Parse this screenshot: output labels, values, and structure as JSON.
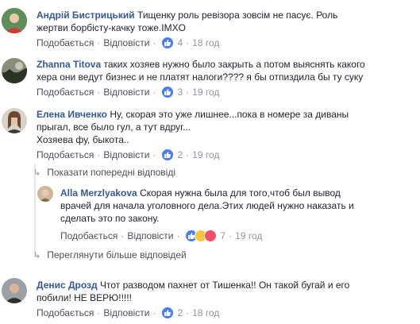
{
  "comments": [
    {
      "author": "Андрій Бистрицький",
      "text_line1": "Тищенку роль ревізора зовсім не пасує. Роль",
      "text_line2": "жертви борбісту-качку тоже.IMXO",
      "like_label": "Подобається",
      "reply_label": "Відповісти",
      "reaction_count": "4",
      "time": "18 год",
      "avatar_icon": "user-avatar-icon"
    },
    {
      "author": "Zhanna Titova",
      "text_line1": "таких хозяев нужно было закрыть а потом выяснять какого",
      "text_line2": "хера они ведут бизнес и не платят налоги???? я бы отпиздила бы ту суку",
      "like_label": "Подобається",
      "reply_label": "Відповісти",
      "reaction_count": "3",
      "time": "19 год",
      "avatar_icon": "user-avatar-icon"
    },
    {
      "author": "Елена Ивченко",
      "text_line1": "Ну, скорая это уже лишнее...пока в номере за диваны",
      "text_line2": "прыгал, все было гул, а тут вдруг...",
      "text_line3": "Хозяева фу, быкота..",
      "like_label": "Подобається",
      "reply_label": "Відповісти",
      "reaction_count": "2",
      "time": "19 год",
      "avatar_icon": "user-avatar-icon"
    }
  ],
  "show_previous_replies": "Показати попередні відповіді",
  "reply": {
    "author": "Alla Merzlyakova",
    "text_line1": "Скорая нужна была для того,чтоб был вывод",
    "text_line2": "врачей для начала уголовного дела.Этих людей нужно наказать и",
    "text_line3": "сделать это по закону.",
    "like_label": "Подобається",
    "reply_label": "Відповісти",
    "reaction_count": "7",
    "time": "19 год"
  },
  "show_more_replies": "Переглянути більше відповідей",
  "last_comment": {
    "author": "Денис Дрозд",
    "text_line1": "Чтот разводом пахнет от Тишенка!! Он такой бугай и его",
    "text_line2": "побили! НЕ ВЕРЮ!!!!!",
    "like_label": "Подобається",
    "reply_label": "Відповісти",
    "reaction_count": "2",
    "time": "18 год"
  },
  "colors": {
    "author": "#365899",
    "text": "#1d2129",
    "meta": "#90949c",
    "like": "#4a7df5"
  }
}
